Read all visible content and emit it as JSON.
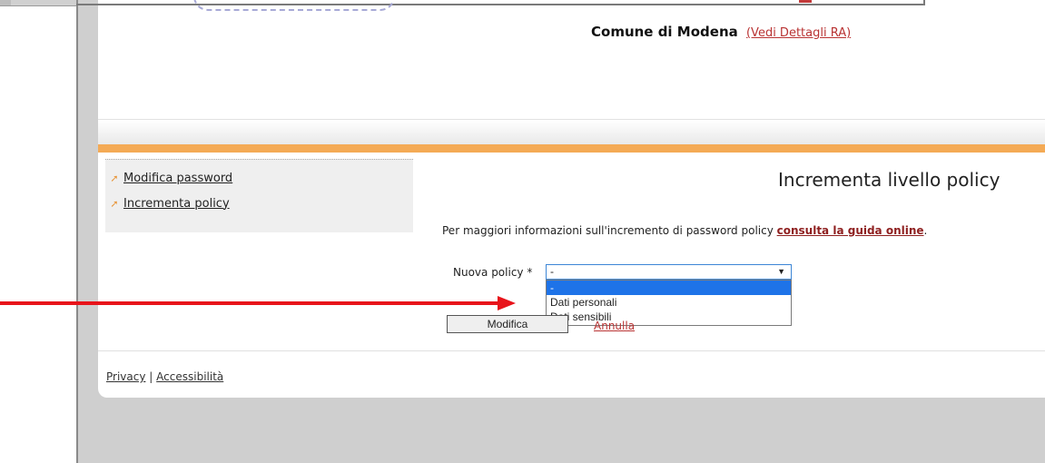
{
  "header": {
    "ente_name": "Comune di Modena",
    "ente_link": "(Vedi Dettagli RA)"
  },
  "sidebar": {
    "items": [
      {
        "label": "Modifica password"
      },
      {
        "label": "Incrementa policy"
      }
    ]
  },
  "main": {
    "title": "Incrementa livello policy",
    "info_text": "Per maggiori informazioni sull'incremento di password policy ",
    "info_link": "consulta la guida online",
    "info_suffix": ".",
    "policy_label": "Nuova policy *",
    "select_value": "-",
    "options": [
      "-",
      "Dati personali",
      "Dati sensibili"
    ],
    "submit_label": "Modifica",
    "cancel_label": "Annulla"
  },
  "footer": {
    "privacy": "Privacy",
    "separator": "|",
    "accessibility": "Accessibilità"
  },
  "colors": {
    "accent_orange": "#f4aa55",
    "link_red": "#b93333",
    "selected_blue": "#1e73e8",
    "annotation_arrow": "#e8141b"
  }
}
